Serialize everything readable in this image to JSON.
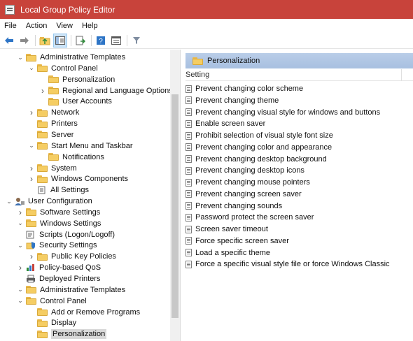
{
  "window": {
    "title": "Local Group Policy Editor"
  },
  "menu": [
    "File",
    "Action",
    "View",
    "Help"
  ],
  "toolbar": {
    "buttons": [
      "back-icon",
      "forward-icon",
      "up-folder-icon",
      "show-hide-tree-icon",
      "export-list-icon",
      "help-icon",
      "properties-icon",
      "filter-icon"
    ]
  },
  "tree": [
    {
      "label": "Administrative Templates",
      "level": 2,
      "arrow": "down"
    },
    {
      "label": "Control Panel",
      "level": 3,
      "arrow": "down"
    },
    {
      "label": "Personalization",
      "level": 4,
      "arrow": ""
    },
    {
      "label": "Regional and Language Options",
      "level": 4,
      "arrow": "right"
    },
    {
      "label": "User Accounts",
      "level": 4,
      "arrow": ""
    },
    {
      "label": "Network",
      "level": 3,
      "arrow": "right"
    },
    {
      "label": "Printers",
      "level": 3,
      "arrow": ""
    },
    {
      "label": "Server",
      "level": 3,
      "arrow": ""
    },
    {
      "label": "Start Menu and Taskbar",
      "level": 3,
      "arrow": "down"
    },
    {
      "label": "Notifications",
      "level": 4,
      "arrow": ""
    },
    {
      "label": "System",
      "level": 3,
      "arrow": "right"
    },
    {
      "label": "Windows Components",
      "level": 3,
      "arrow": "right"
    },
    {
      "label": "All Settings",
      "level": 3,
      "arrow": ""
    },
    {
      "label": "User Configuration",
      "level": 0,
      "arrow": "down"
    },
    {
      "label": "Software Settings",
      "level": 1,
      "arrow": "right"
    },
    {
      "label": "Windows Settings",
      "level": 1,
      "arrow": "down"
    },
    {
      "label": "Scripts (Logon/Logoff)",
      "level": 2,
      "arrow": ""
    },
    {
      "label": "Security Settings",
      "level": 2,
      "arrow": "down"
    },
    {
      "label": "Public Key Policies",
      "level": 3,
      "arrow": "right"
    },
    {
      "label": "Policy-based QoS",
      "level": 2,
      "arrow": "right"
    },
    {
      "label": "Deployed Printers",
      "level": 2,
      "arrow": ""
    },
    {
      "label": "Administrative Templates",
      "level": 1,
      "arrow": "down"
    },
    {
      "label": "Control Panel",
      "level": 2,
      "arrow": "down"
    },
    {
      "label": "Add or Remove Programs",
      "level": 3,
      "arrow": ""
    },
    {
      "label": "Display",
      "level": 3,
      "arrow": ""
    },
    {
      "label": "Personalization",
      "level": 3,
      "arrow": "",
      "selected": true
    }
  ],
  "right": {
    "folder_title": "Personalization",
    "column_header": "Setting",
    "policies": [
      "Prevent changing color scheme",
      "Prevent changing theme",
      "Prevent changing visual style for windows and buttons",
      "Enable screen saver",
      "Prohibit selection of visual style font size",
      "Prevent changing color and appearance",
      "Prevent changing desktop background",
      "Prevent changing desktop icons",
      "Prevent changing mouse pointers",
      "Prevent changing screen saver",
      "Prevent changing sounds",
      "Password protect the screen saver",
      "Screen saver timeout",
      "Force specific screen saver",
      "Load a specific theme",
      "Force a specific visual style file or force Windows Classic"
    ]
  },
  "colors": {
    "titlebar": "#c8433b",
    "header": "#b9cde8",
    "folder": "#f5cd63"
  }
}
